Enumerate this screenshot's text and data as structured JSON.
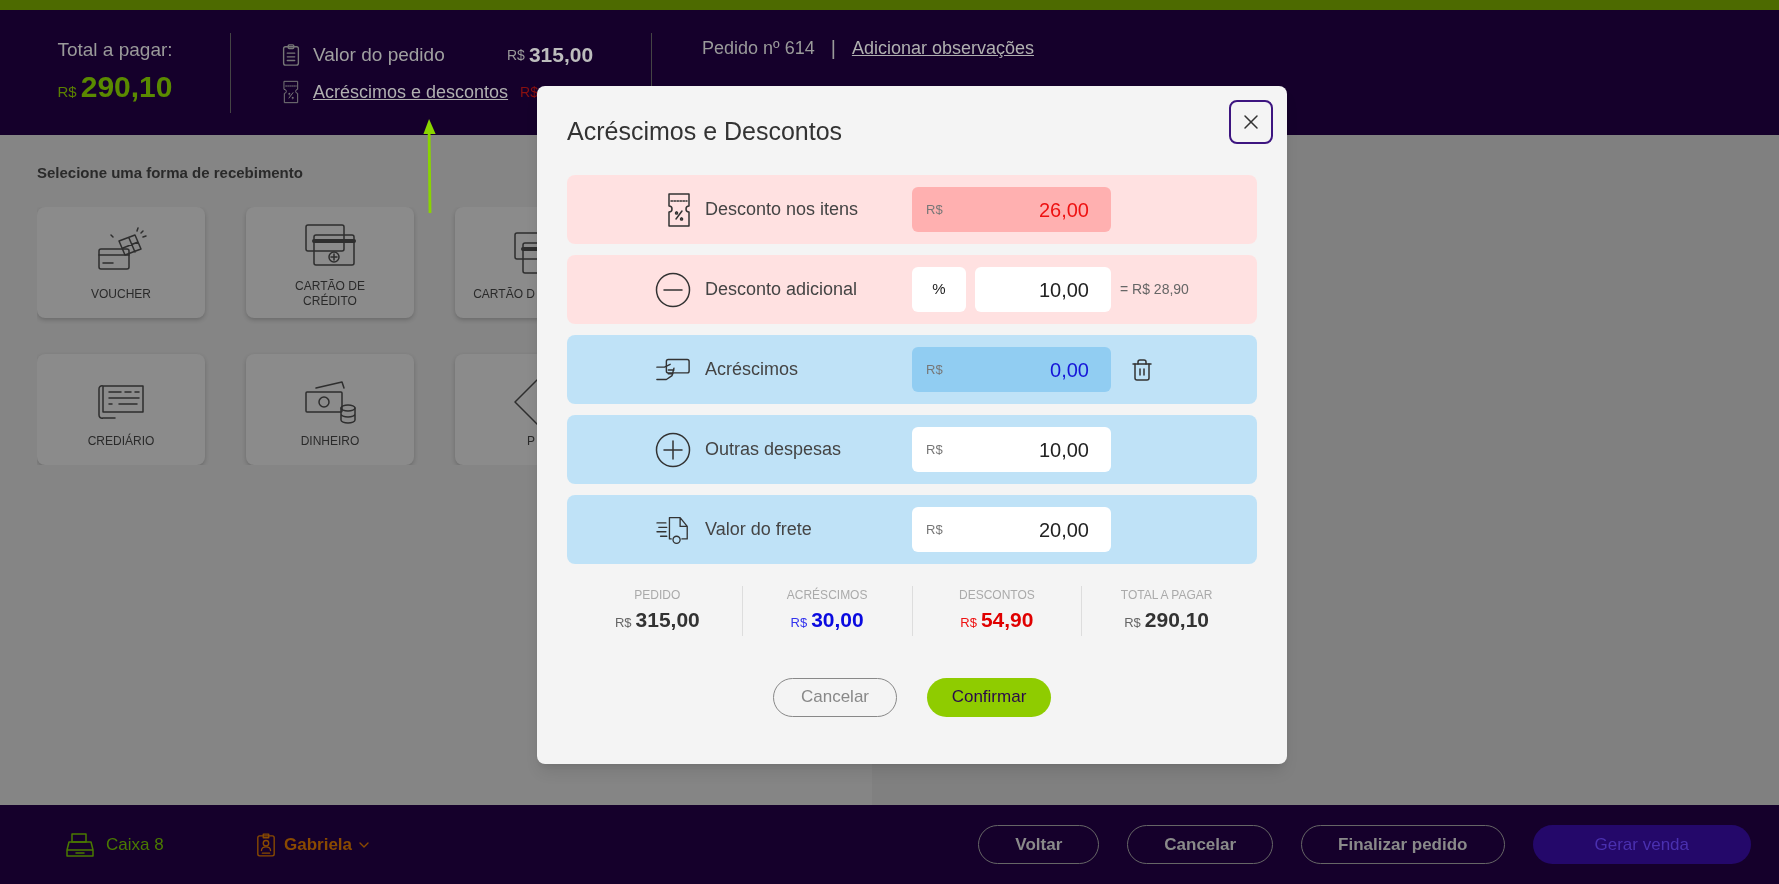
{
  "header": {
    "total_label": "Total a pagar:",
    "total_currency": "R$",
    "total_value": "290,10",
    "order_value_label": "Valor do pedido",
    "order_value_currency": "R$",
    "order_value": "315,00",
    "adjustments_link": "Acréscimos e descontos",
    "adjustments_currency": "R$",
    "order_number": "Pedido nº 614",
    "separator": "|",
    "notes_link": "Adicionar observações"
  },
  "payment": {
    "title": "Selecione uma forma de recebimento",
    "methods": [
      {
        "label": "VOUCHER"
      },
      {
        "label": "CARTÃO DE CRÉDITO"
      },
      {
        "label": "CARTÃO D"
      },
      {
        "label": "CREDIÁRIO"
      },
      {
        "label": "DINHEIRO"
      },
      {
        "label": "P"
      }
    ]
  },
  "modal": {
    "title": "Acréscimos e Descontos",
    "rows": [
      {
        "kind": "discount",
        "label": "Desconto nos itens",
        "field": {
          "currency": "R$",
          "value": "26,00",
          "disabled": true
        }
      },
      {
        "kind": "discount",
        "label": "Desconto adicional",
        "unit": "%",
        "field": {
          "value": "10,00",
          "disabled": false
        },
        "equivalent": "= R$ 28,90"
      },
      {
        "kind": "addition",
        "label": "Acréscimos",
        "field": {
          "currency": "R$",
          "value": "0,00",
          "disabled": true
        },
        "deletable": true
      },
      {
        "kind": "addition",
        "label": "Outras despesas",
        "field": {
          "currency": "R$",
          "value": "10,00",
          "disabled": false
        }
      },
      {
        "kind": "addition",
        "label": "Valor do frete",
        "field": {
          "currency": "R$",
          "value": "20,00",
          "disabled": false
        }
      }
    ],
    "summary": [
      {
        "kind": "neutral",
        "label": "PEDIDO",
        "currency": "R$",
        "value": "315,00"
      },
      {
        "kind": "addition",
        "label": "ACRÉSCIMOS",
        "currency": "R$",
        "value": "30,00"
      },
      {
        "kind": "discount",
        "label": "DESCONTOS",
        "currency": "R$",
        "value": "54,90"
      },
      {
        "kind": "neutral",
        "label": "TOTAL A PAGAR",
        "currency": "R$",
        "value": "290,10"
      }
    ],
    "buttons": [
      {
        "kind": "secondary",
        "label": "Cancelar"
      },
      {
        "kind": "primary",
        "label": "Confirmar"
      }
    ]
  },
  "footer": {
    "register": "Caixa 8",
    "operator": "Gabriela",
    "buttons": [
      {
        "kind": "outline",
        "label": "Voltar"
      },
      {
        "kind": "outline",
        "label": "Cancelar"
      },
      {
        "kind": "outline",
        "label": "Finalizar pedido"
      },
      {
        "kind": "primary",
        "label": "Gerar venda"
      }
    ]
  }
}
